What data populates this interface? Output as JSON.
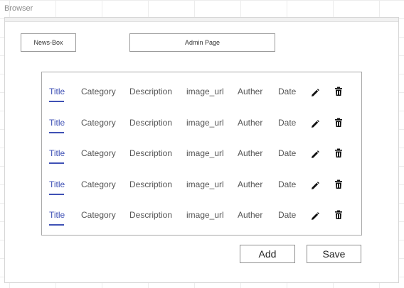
{
  "window": {
    "label": "Browser"
  },
  "header": {
    "newsbox_label": "News-Box",
    "admin_label": "Admin Page"
  },
  "table": {
    "rows": [
      {
        "title": "Title",
        "category": "Category",
        "description": "Description",
        "image_url": "image_url",
        "author": "Auther",
        "date": "Date",
        "edit_icon": "pencil-icon",
        "delete_icon": "trash-icon"
      },
      {
        "title": "Title",
        "category": "Category",
        "description": "Description",
        "image_url": "image_url",
        "author": "Auther",
        "date": "Date",
        "edit_icon": "pencil-icon",
        "delete_icon": "trash-icon"
      },
      {
        "title": "Title",
        "category": "Category",
        "description": "Description",
        "image_url": "image_url",
        "author": "Auther",
        "date": "Date",
        "edit_icon": "pencil-icon",
        "delete_icon": "trash-icon"
      },
      {
        "title": "Title",
        "category": "Category",
        "description": "Description",
        "image_url": "image_url",
        "author": "Auther",
        "date": "Date",
        "edit_icon": "pencil-icon",
        "delete_icon": "trash-icon"
      },
      {
        "title": "Title",
        "category": "Category",
        "description": "Description",
        "image_url": "image_url",
        "author": "Auther",
        "date": "Date",
        "edit_icon": "pencil-icon",
        "delete_icon": "trash-icon"
      }
    ]
  },
  "actions": {
    "add_label": "Add",
    "save_label": "Save"
  },
  "colors": {
    "accent": "#3f51b5",
    "text": "#555555",
    "border": "#a8a8a8"
  }
}
